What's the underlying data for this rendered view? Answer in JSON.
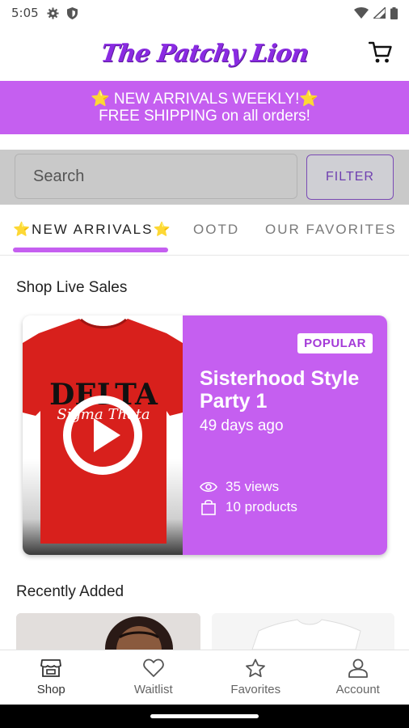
{
  "status_bar": {
    "time": "5:05"
  },
  "header": {
    "logo_text": "The Patchy Lion"
  },
  "promo": {
    "line1": "⭐ NEW ARRIVALS WEEKLY!⭐",
    "line2": "FREE SHIPPING on all orders!"
  },
  "search": {
    "placeholder": "Search",
    "filter_label": "FILTER"
  },
  "tabs": [
    {
      "label": "⭐NEW ARRIVALS⭐",
      "active": true
    },
    {
      "label": "OOTD",
      "active": false
    },
    {
      "label": "OUR FAVORITES",
      "active": false
    }
  ],
  "live_sales": {
    "section_title": "Shop Live Sales",
    "card": {
      "shirt_text_main": "DELTA",
      "shirt_text_script": "Sigma Theta",
      "badge": "POPULAR",
      "title": "Sisterhood Style Party 1",
      "time_ago": "49 days ago",
      "views": "35 views",
      "products": "10 products"
    }
  },
  "recently_added": {
    "section_title": "Recently Added"
  },
  "bottom_nav": [
    {
      "label": "Shop",
      "icon": "store-icon"
    },
    {
      "label": "Waitlist",
      "icon": "heart-icon"
    },
    {
      "label": "Favorites",
      "icon": "star-icon"
    },
    {
      "label": "Account",
      "icon": "person-icon"
    }
  ],
  "colors": {
    "brand_purple": "#c55ff0",
    "logo_purple": "#8a2be2",
    "filter_purple": "#6f3fb0",
    "shirt_red": "#d8201c"
  }
}
